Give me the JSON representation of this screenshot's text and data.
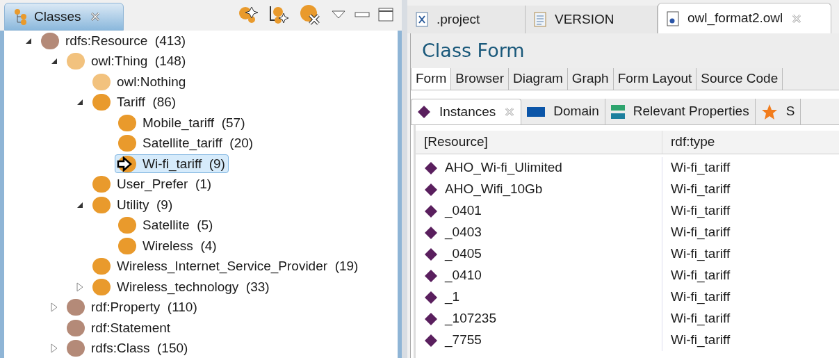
{
  "classes_view": {
    "title": "Classes",
    "tree": [
      {
        "label": "rdfs:Resource",
        "count": "(413)",
        "color": "#b48a78",
        "expanded": true,
        "selected": false,
        "children": [
          {
            "label": "owl:Thing",
            "count": "(148)",
            "color": "#f2c27e",
            "expanded": true,
            "selected": false,
            "children": [
              {
                "label": "owl:Nothing",
                "color": "#f2c27e",
                "selected": false
              },
              {
                "label": "Tariff",
                "count": "(86)",
                "color": "#e99a2c",
                "expanded": true,
                "selected": false,
                "children": [
                  {
                    "label": "Mobile_tariff",
                    "count": "(57)",
                    "color": "#e99a2c",
                    "selected": false
                  },
                  {
                    "label": "Satellite_tariff",
                    "count": "(20)",
                    "color": "#e99a2c",
                    "selected": false
                  },
                  {
                    "label": "Wi-fi_tariff",
                    "count": "(9)",
                    "color": "#e99a2c",
                    "selected": true
                  }
                ]
              },
              {
                "label": "User_Prefer",
                "count": "(1)",
                "color": "#e99a2c",
                "selected": false
              },
              {
                "label": "Utility",
                "count": "(9)",
                "color": "#e99a2c",
                "expanded": true,
                "selected": false,
                "children": [
                  {
                    "label": "Satellite",
                    "count": "(5)",
                    "color": "#e99a2c",
                    "selected": false
                  },
                  {
                    "label": "Wireless",
                    "count": "(4)",
                    "color": "#e99a2c",
                    "selected": false
                  }
                ]
              },
              {
                "label": "Wireless_Internet_Service_Provider",
                "count": "(19)",
                "color": "#e99a2c",
                "selected": false
              },
              {
                "label": "Wireless_technology",
                "count": "(33)",
                "color": "#e99a2c",
                "expanded": false,
                "selected": false
              }
            ]
          },
          {
            "label": "rdf:Property",
            "count": "(110)",
            "color": "#b48a78",
            "expanded": false,
            "selected": false
          },
          {
            "label": "rdf:Statement",
            "color": "#b48a78",
            "selected": false
          },
          {
            "label": "rdfs:Class",
            "count": "(150)",
            "color": "#b48a78",
            "expanded": false,
            "selected": false
          }
        ]
      }
    ]
  },
  "editor_tabs": [
    {
      "label": ".project",
      "kind": "xml",
      "selected": false
    },
    {
      "label": "VERSION",
      "kind": "text",
      "selected": false
    },
    {
      "label": "owl_format2.owl",
      "kind": "owl",
      "selected": true
    }
  ],
  "form_title": "Class Form",
  "form_tabs": [
    {
      "label": "Form",
      "selected": true
    },
    {
      "label": "Browser",
      "selected": false
    },
    {
      "label": "Diagram",
      "selected": false
    },
    {
      "label": "Graph",
      "selected": false
    },
    {
      "label": "Form Layout",
      "selected": false
    },
    {
      "label": "Source Code",
      "selected": false
    }
  ],
  "widget_tabs": [
    {
      "label": "Instances",
      "kind": "instances",
      "selected": true
    },
    {
      "label": "Domain",
      "kind": "domain",
      "selected": false
    },
    {
      "label": "Relevant Properties",
      "kind": "properties",
      "selected": false
    },
    {
      "label": "S",
      "kind": "star",
      "selected": false
    }
  ],
  "table": {
    "columns": [
      "[Resource]",
      "rdf:type"
    ],
    "rows": [
      [
        "AHO_Wi-fi_Ulimited",
        "Wi-fi_tariff"
      ],
      [
        "AHO_Wifi_10Gb",
        "Wi-fi_tariff"
      ],
      [
        "_0401",
        "Wi-fi_tariff"
      ],
      [
        "_0403",
        "Wi-fi_tariff"
      ],
      [
        "_0405",
        "Wi-fi_tariff"
      ],
      [
        "_0410",
        "Wi-fi_tariff"
      ],
      [
        "_1",
        "Wi-fi_tariff"
      ],
      [
        "_107235",
        "Wi-fi_tariff"
      ],
      [
        "_7755",
        "Wi-fi_tariff"
      ]
    ]
  }
}
